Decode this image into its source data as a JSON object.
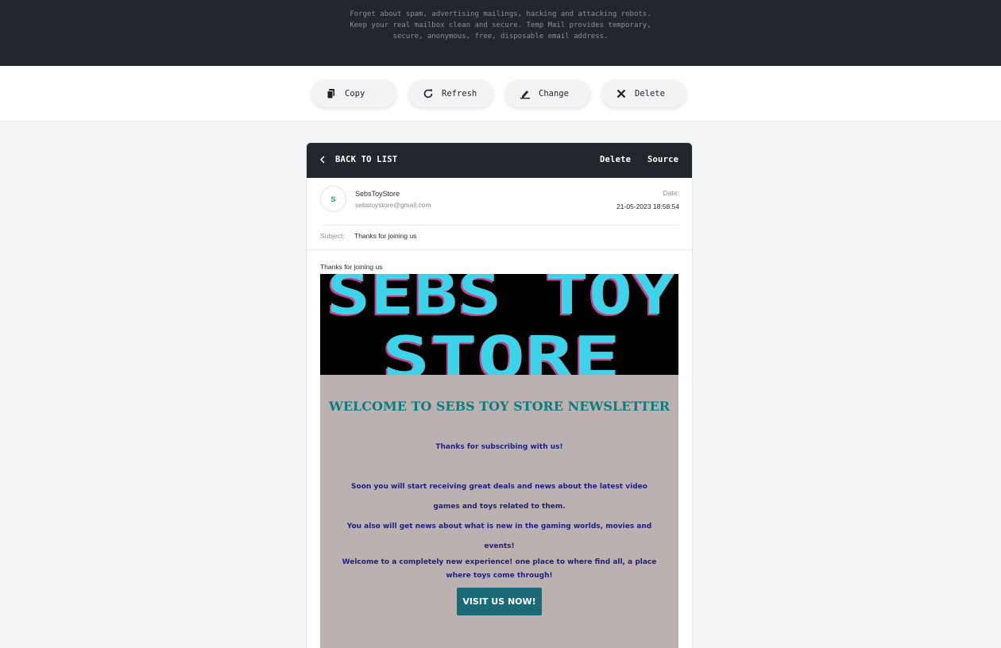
{
  "header": {
    "tagline": [
      "Forget about spam, advertising mailings, hacking and attacking robots.",
      "Keep your real mailbox clean and secure. Temp Mail provides temporary,",
      "secure, anonymous, free, disposable email address."
    ]
  },
  "actions": {
    "copy": {
      "label": "Copy",
      "icon": "copy-icon"
    },
    "refresh": {
      "label": "Refresh",
      "icon": "refresh-icon"
    },
    "change": {
      "label": "Change",
      "icon": "edit-icon"
    },
    "delete": {
      "label": "Delete",
      "icon": "close-icon"
    }
  },
  "message": {
    "back_label": "BACK TO LIST",
    "delete_label": "Delete",
    "source_label": "Source",
    "avatar_initial": "S",
    "sender_name": "SebsToyStore",
    "sender_email": "sebstoystore@gmail.com",
    "date_label": "Date:",
    "date_value": "21-05-2023 18:58:54",
    "subject_label": "Subject:",
    "subject": "Thanks for joining us",
    "preheader": "Thanks for joining us"
  },
  "newsletter": {
    "logo_text": [
      "SEBS TOY",
      "STORE"
    ],
    "title": "WELCOME TO SEBS TOY STORE NEWSLETTER",
    "line1": "Thanks for subscribing with us!",
    "line2": "Soon you will start receiving great deals and news about the latest video",
    "line3": "games and toys related to them.",
    "line4": "You also will get news about what is new in the gaming worlds, movies and",
    "line5": "events!",
    "line6": "Welcome to a completely new experience! one place to where find all, a place",
    "line7": "where toys come through!",
    "cta": "VISIT US NOW!",
    "colors": {
      "background": "#bcb1b1",
      "title": "#117a7d",
      "text": "#1f1f7a",
      "button": "#1b6a78",
      "logo": "#3dd4ea"
    }
  }
}
